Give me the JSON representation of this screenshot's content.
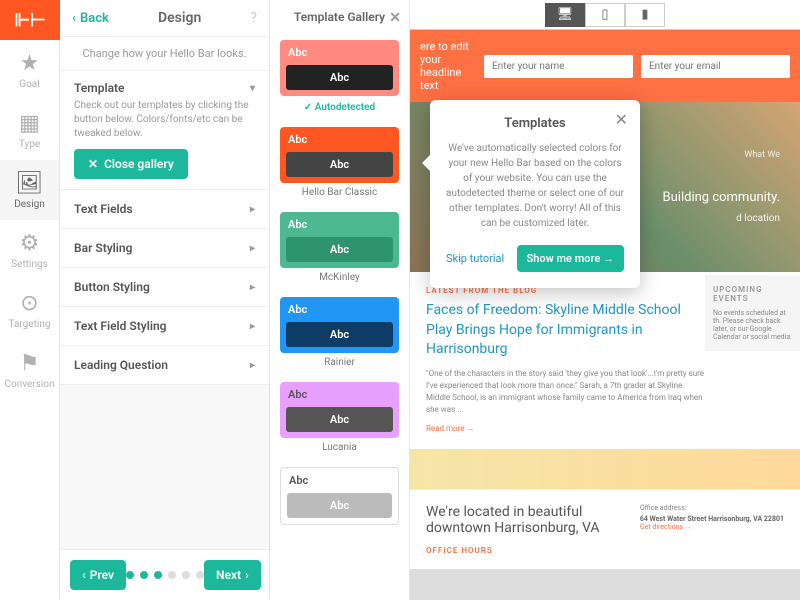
{
  "nav": {
    "items": [
      {
        "label": "Goal"
      },
      {
        "label": "Type"
      },
      {
        "label": "Design"
      },
      {
        "label": "Settings"
      },
      {
        "label": "Targeting"
      },
      {
        "label": "Conversion"
      }
    ]
  },
  "panel": {
    "back": "Back",
    "title": "Design",
    "desc": "Change how your Hello Bar looks.",
    "template_head": "Template",
    "template_sub": "Check out our templates by clicking the button below. Colors/fonts/etc can be tweaked below.",
    "close_gallery": "Close gallery",
    "rows": [
      "Text Fields",
      "Bar Styling",
      "Button Styling",
      "Text Field Styling",
      "Leading Question"
    ],
    "prev": "Prev",
    "next": "Next"
  },
  "gallery": {
    "title": "Template Gallery",
    "abc": "Abc",
    "autodetected": "Autodetected",
    "templates": [
      {
        "name": "Autodetected",
        "top_bg": "#ff8a80",
        "top_fg": "#fff",
        "bot_bg": "#222",
        "bot_fg": "#fff"
      },
      {
        "name": "Hello Bar Classic",
        "top_bg": "#ff5722",
        "top_fg": "#fff",
        "bot_bg": "#444",
        "bot_fg": "#fff"
      },
      {
        "name": "McKinley",
        "top_bg": "#4db892",
        "top_fg": "#fff",
        "bot_bg": "#2e9470",
        "bot_fg": "#fff"
      },
      {
        "name": "Rainier",
        "top_bg": "#2196f3",
        "top_fg": "#fff",
        "bot_bg": "#0d3d66",
        "bot_fg": "#fff"
      },
      {
        "name": "Lucania",
        "top_bg": "#e8a0ff",
        "top_fg": "#555",
        "bot_bg": "#555",
        "bot_fg": "#fff"
      },
      {
        "name": "",
        "top_bg": "#fff",
        "top_fg": "#555",
        "bot_bg": "#bbb",
        "bot_fg": "#fff"
      }
    ]
  },
  "popover": {
    "title": "Templates",
    "body": "We've automatically selected colors for your new Hello Bar based on the colors of your website. You can use the autodetected theme or select one of our other templates. Don't worry! All of this can be customized later.",
    "skip": "Skip tutorial",
    "more": "Show me more →"
  },
  "preview": {
    "headline": "ere to edit your headline text",
    "name_ph": "Enter your name",
    "email_ph": "Enter your email",
    "hero_top": "What We",
    "hero_text": "Building community.",
    "hero_loc": "d location",
    "blog_label": "LATEST FROM THE BLOG",
    "blog_title": "Faces of Freedom: Skyline Middle School Play Brings Hope for Immigrants in Harrisonburg",
    "blog_excerpt": "\"One of the characters in the story said 'they give you that look'...I'm pretty sure I've experienced that look more than once.\" Sarah, a 7th grader at Skyline Middle School, is an immigrant whose family came to America from Iraq when she was ...",
    "read_more": "Read more →",
    "events_label": "UPCOMING EVENTS",
    "events_text": "No events scheduled at th. Please check back later, or our Google Calendar or social media.",
    "loc_title": "We're located in beautiful downtown Harrisonburg, VA",
    "office_hours": "OFFICE HOURS",
    "office_addr_label": "Office address:",
    "office_addr": "64 West Water Street\nHarrisonburg, VA 22801",
    "directions": "Get directions →"
  }
}
